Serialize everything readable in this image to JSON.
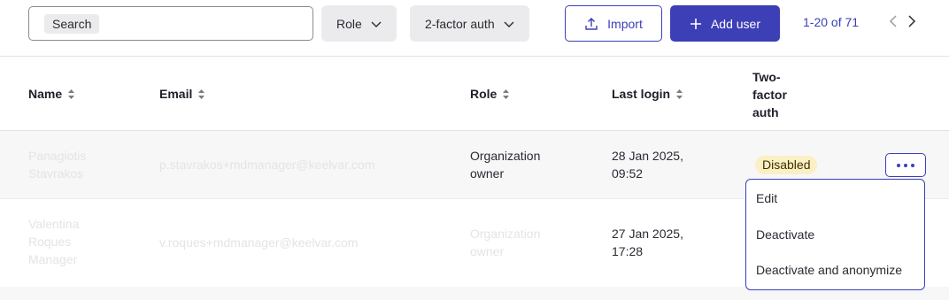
{
  "toolbar": {
    "search_placeholder": "Search",
    "role_filter": "Role",
    "twofa_filter": "2-factor auth",
    "import_label": "Import",
    "add_user_label": "Add user",
    "pagination": "1-20 of 71"
  },
  "table": {
    "headers": {
      "name": "Name",
      "email": "Email",
      "role": "Role",
      "last_login": "Last login",
      "two_factor": [
        "Two-",
        "factor",
        "auth"
      ]
    },
    "rows": [
      {
        "name_lines": [
          "Panagiotis",
          "Stavrakos"
        ],
        "email": "p.stavrakos+mdmanager@keelvar.com",
        "role_lines": [
          "Organization",
          "owner"
        ],
        "last_login_lines": [
          "28 Jan 2025,",
          "09:52"
        ],
        "two_factor": "Disabled"
      },
      {
        "name_lines": [
          "Valentina",
          "Roques",
          "Manager"
        ],
        "email": "v.roques+mdmanager@keelvar.com",
        "role_lines": [
          "Organization",
          "owner"
        ],
        "last_login_lines": [
          "27 Jan 2025,",
          "17:28"
        ]
      }
    ]
  },
  "row_menu": {
    "items": [
      "Edit",
      "Deactivate",
      "Deactivate and anonymize"
    ]
  },
  "colors": {
    "accent": "#3d3fb6",
    "badge_bg": "#fbefc4",
    "row_bg": "#f7f7f8"
  }
}
